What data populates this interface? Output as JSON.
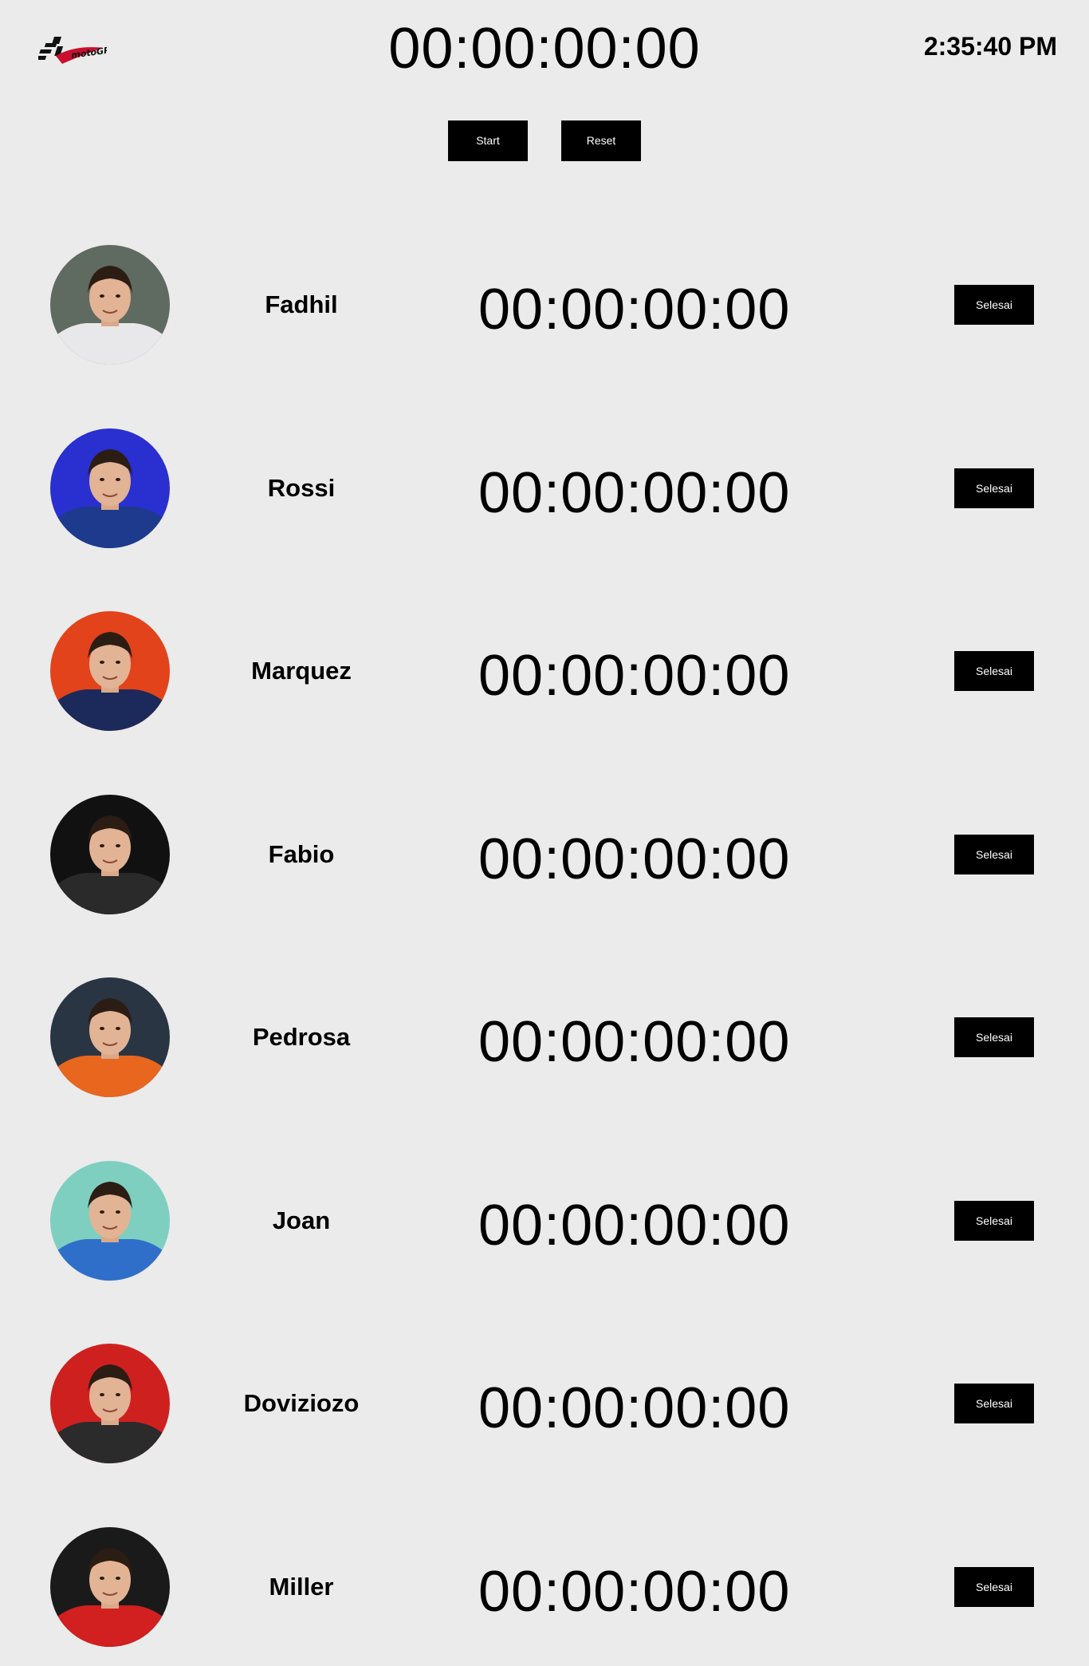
{
  "header": {
    "logo_icon": "motogp-logo",
    "logo_text": "motoGP",
    "main_timer": "00:00:00:00",
    "clock": "2:35:40 PM"
  },
  "controls": {
    "start_label": "Start",
    "reset_label": "Reset"
  },
  "colors": {
    "background": "#ebebeb",
    "button_bg": "#000000",
    "button_text": "#ffffff"
  },
  "riders": [
    {
      "name": "Fadhil",
      "timer": "00:00:00:00",
      "button_label": "Selesai",
      "avatar_icon": "rider-photo",
      "avatar_bg": "#5f6a60",
      "avatar_accent": "#e8e8ea"
    },
    {
      "name": "Rossi",
      "timer": "00:00:00:00",
      "button_label": "Selesai",
      "avatar_icon": "rider-photo",
      "avatar_bg": "#2a2fd0",
      "avatar_accent": "#1d3a8c"
    },
    {
      "name": "Marquez",
      "timer": "00:00:00:00",
      "button_label": "Selesai",
      "avatar_icon": "rider-photo",
      "avatar_bg": "#e2431b",
      "avatar_accent": "#1b2a5a"
    },
    {
      "name": "Fabio",
      "timer": "00:00:00:00",
      "button_label": "Selesai",
      "avatar_icon": "rider-photo",
      "avatar_bg": "#111111",
      "avatar_accent": "#2a2a2a"
    },
    {
      "name": "Pedrosa",
      "timer": "00:00:00:00",
      "button_label": "Selesai",
      "avatar_icon": "rider-photo",
      "avatar_bg": "#2a3544",
      "avatar_accent": "#e8661e"
    },
    {
      "name": "Joan",
      "timer": "00:00:00:00",
      "button_label": "Selesai",
      "avatar_icon": "rider-photo",
      "avatar_bg": "#7fcfc0",
      "avatar_accent": "#2f6fc9"
    },
    {
      "name": "Doviziozo",
      "timer": "00:00:00:00",
      "button_label": "Selesai",
      "avatar_icon": "rider-photo",
      "avatar_bg": "#cf2020",
      "avatar_accent": "#2b2b2b"
    },
    {
      "name": "Miller",
      "timer": "00:00:00:00",
      "button_label": "Selesai",
      "avatar_icon": "rider-photo",
      "avatar_bg": "#1a1a1a",
      "avatar_accent": "#d21f1f"
    }
  ]
}
